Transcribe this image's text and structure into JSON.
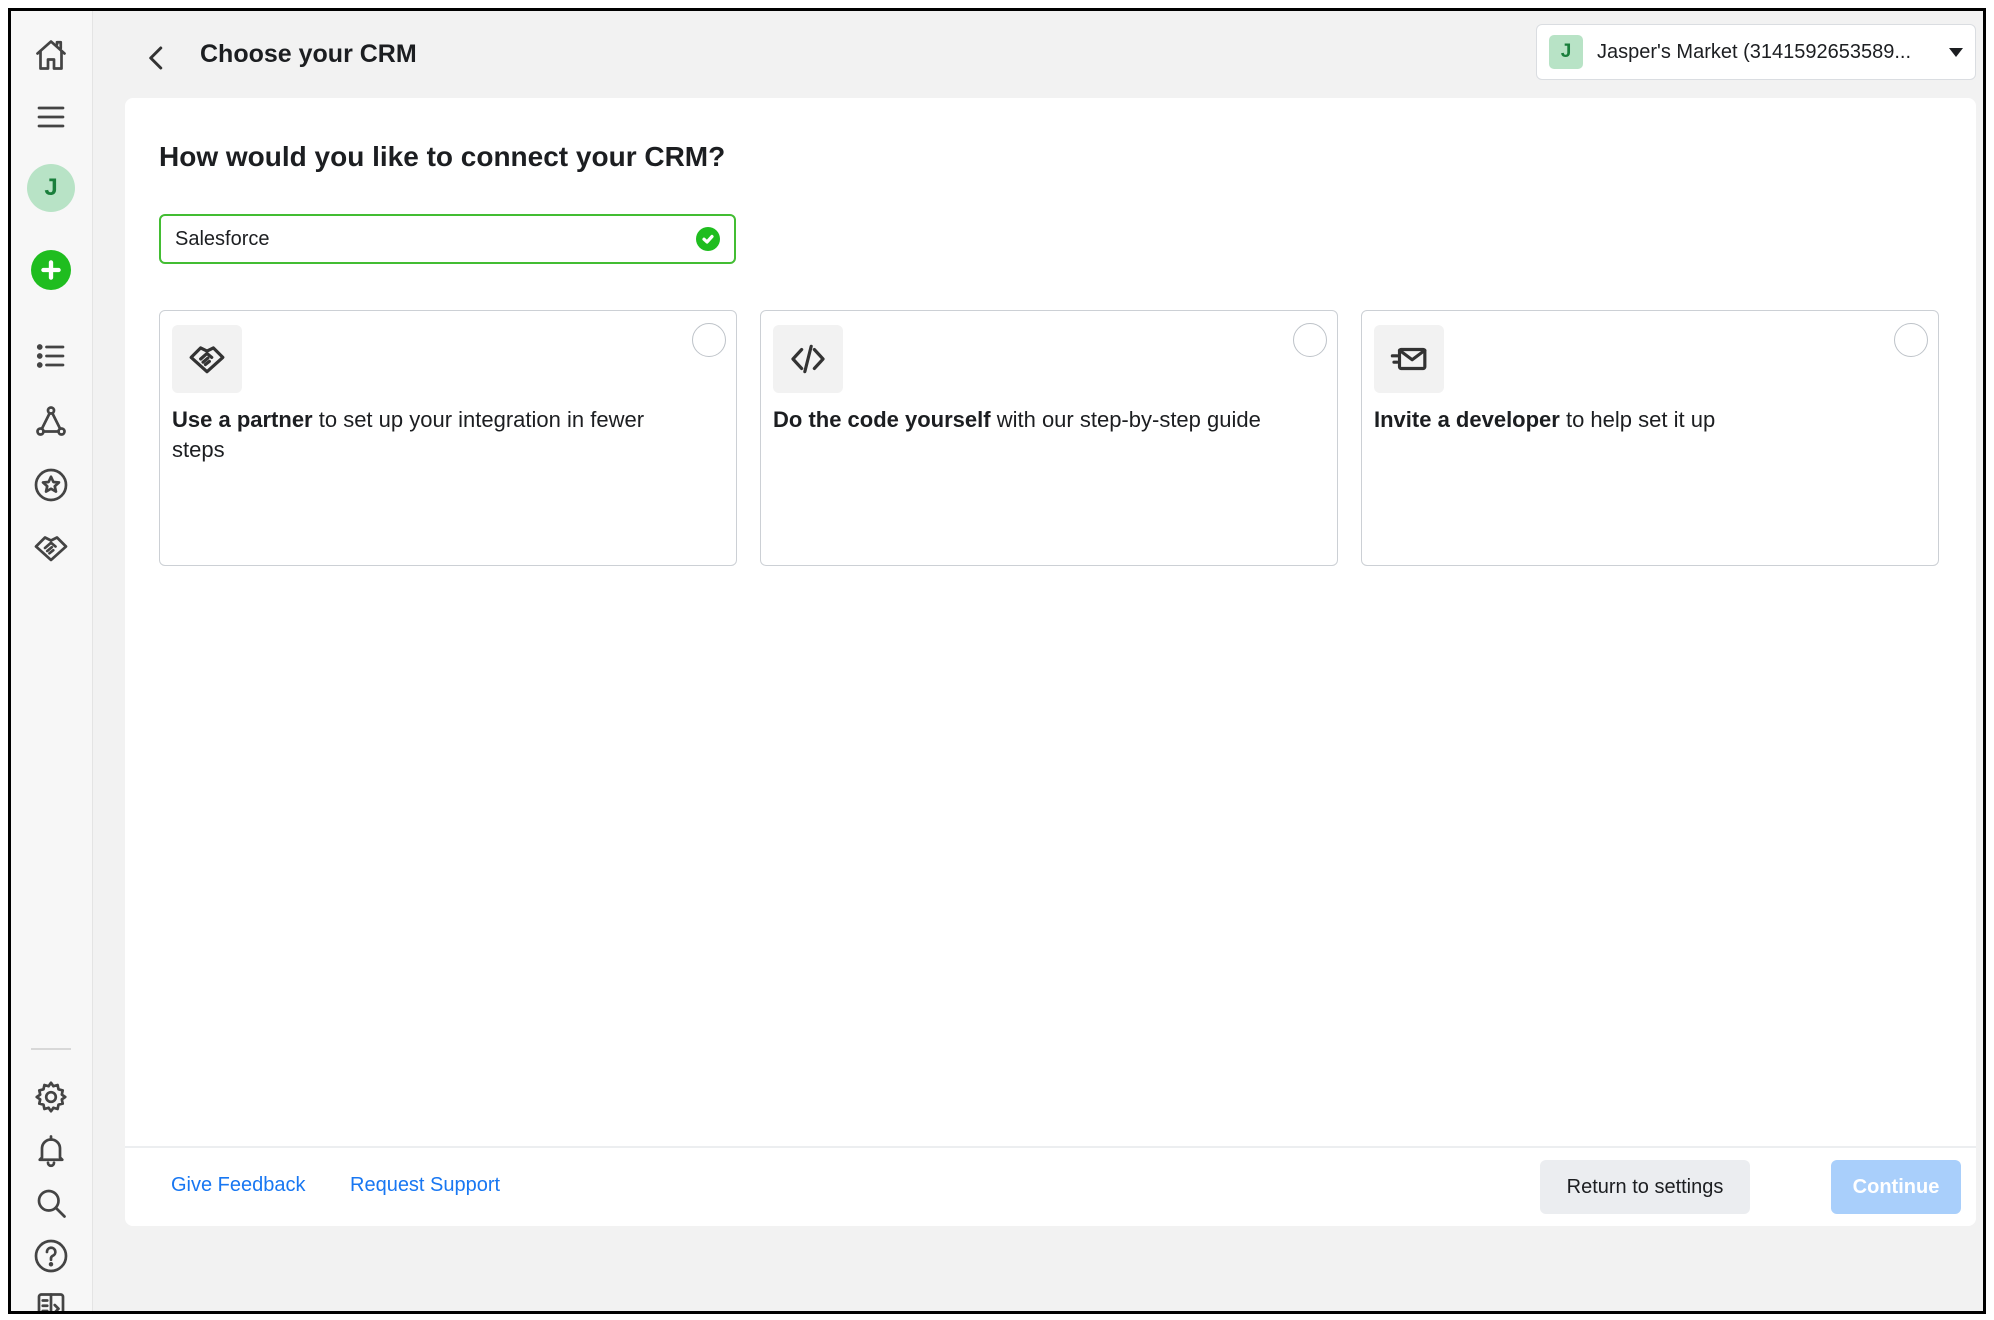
{
  "header": {
    "title": "Choose your CRM",
    "account_initial": "J",
    "account_name": "Jasper's Market (3141592653589..."
  },
  "sidebar": {
    "avatar_initial": "J",
    "icons": [
      "home-icon",
      "menu-icon",
      "list-icon",
      "network-icon",
      "star-icon",
      "handshake-icon",
      "gear-icon",
      "bell-icon",
      "search-icon",
      "help-icon",
      "panel-toggle-icon"
    ]
  },
  "main": {
    "question": "How would you like to connect your CRM?",
    "crm_value": "Salesforce",
    "options": [
      {
        "icon": "handshake-icon",
        "bold": "Use a partner",
        "rest": " to set up your integration in fewer steps"
      },
      {
        "icon": "code-icon",
        "bold": "Do the code yourself",
        "rest": " with our step-by-step guide"
      },
      {
        "icon": "send-mail-icon",
        "bold": "Invite a developer",
        "rest": " to help set it up"
      }
    ]
  },
  "footer": {
    "feedback": "Give Feedback",
    "support": "Request Support",
    "return_label": "Return to settings",
    "continue_label": "Continue"
  },
  "colors": {
    "accent_green": "#1fbd1f",
    "link_blue": "#1877f2",
    "continue_disabled": "#a9cffb"
  }
}
